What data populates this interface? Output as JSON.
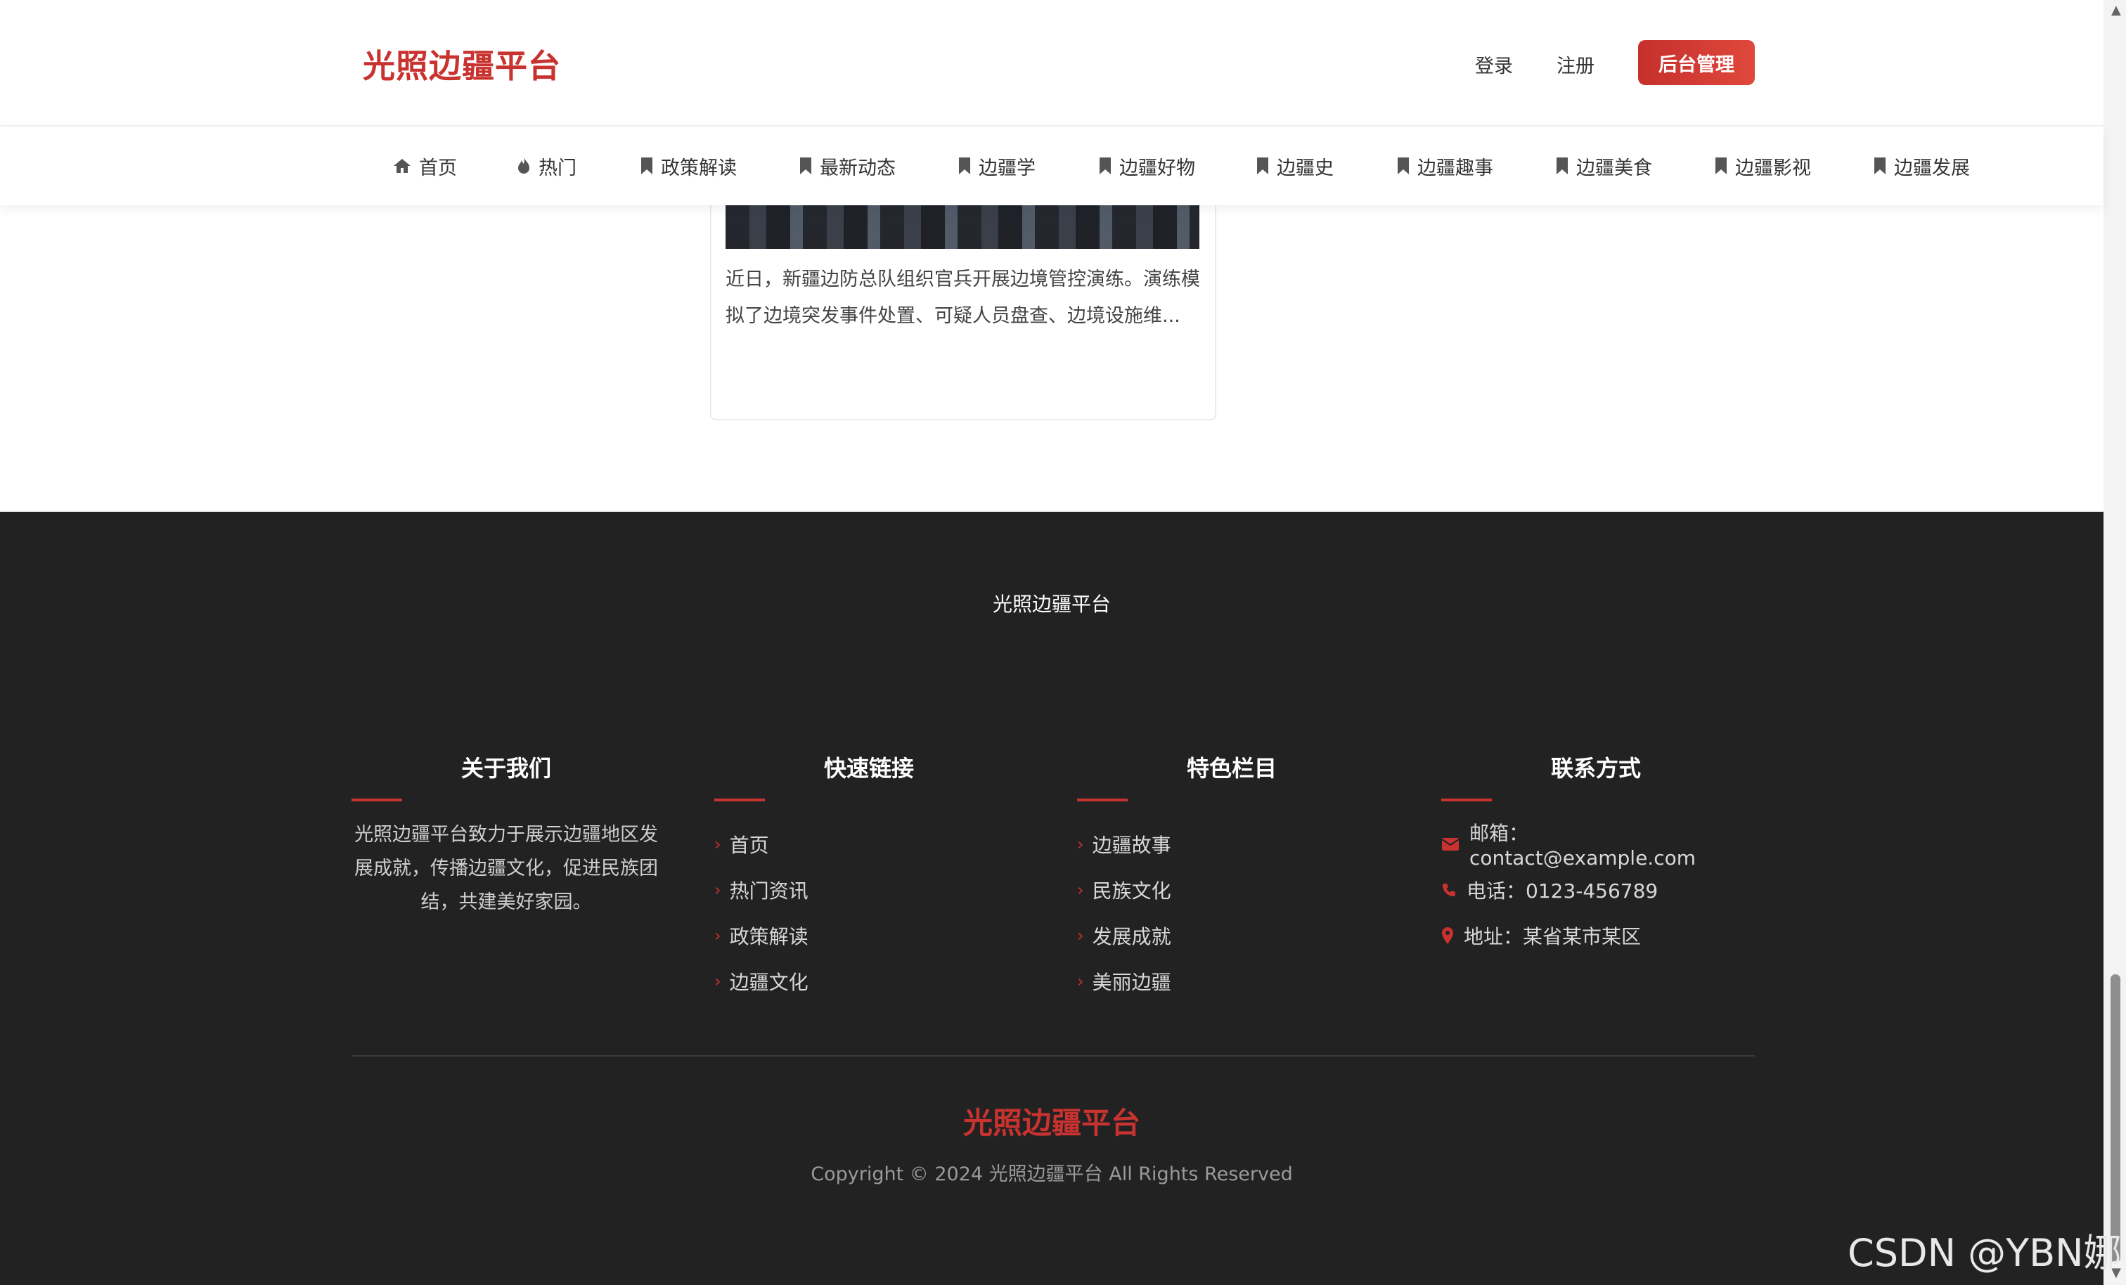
{
  "header": {
    "brand": "光照边疆平台",
    "login": "登录",
    "register": "注册",
    "admin": "后台管理"
  },
  "nav": [
    {
      "label": "首页",
      "icon": "home-icon"
    },
    {
      "label": "热门",
      "icon": "fire-icon"
    },
    {
      "label": "政策解读",
      "icon": "bookmark-icon"
    },
    {
      "label": "最新动态",
      "icon": "bookmark-icon"
    },
    {
      "label": "边疆学",
      "icon": "bookmark-icon"
    },
    {
      "label": "边疆好物",
      "icon": "bookmark-icon"
    },
    {
      "label": "边疆史",
      "icon": "bookmark-icon"
    },
    {
      "label": "边疆趣事",
      "icon": "bookmark-icon"
    },
    {
      "label": "边疆美食",
      "icon": "bookmark-icon"
    },
    {
      "label": "边疆影视",
      "icon": "bookmark-icon"
    },
    {
      "label": "边疆发展",
      "icon": "bookmark-icon"
    }
  ],
  "card": {
    "excerpt": "近日，新疆边防总队组织官兵开展边境管控演练。演练模拟了边境突发事件处置、可疑人员盘查、边境设施维..."
  },
  "footer": {
    "site_name": "光照边疆平台",
    "about": {
      "title": "关于我们",
      "text": "光照边疆平台致力于展示边疆地区发展成就，传播边疆文化，促进民族团结，共建美好家园。"
    },
    "quick_links": {
      "title": "快速链接",
      "items": [
        "首页",
        "热门资讯",
        "政策解读",
        "边疆文化"
      ]
    },
    "featured": {
      "title": "特色栏目",
      "items": [
        "边疆故事",
        "民族文化",
        "发展成就",
        "美丽边疆"
      ]
    },
    "contact": {
      "title": "联系方式",
      "email": "邮箱：contact@example.com",
      "phone": "电话：0123-456789",
      "address": "地址：某省某市某区"
    },
    "brand": "光照边疆平台",
    "copyright": "Copyright © 2024 光照边疆平台 All Rights Reserved"
  },
  "watermark": "CSDN @YBN娜",
  "colors": {
    "accent": "#c8322f",
    "footer_bg": "#232223"
  }
}
